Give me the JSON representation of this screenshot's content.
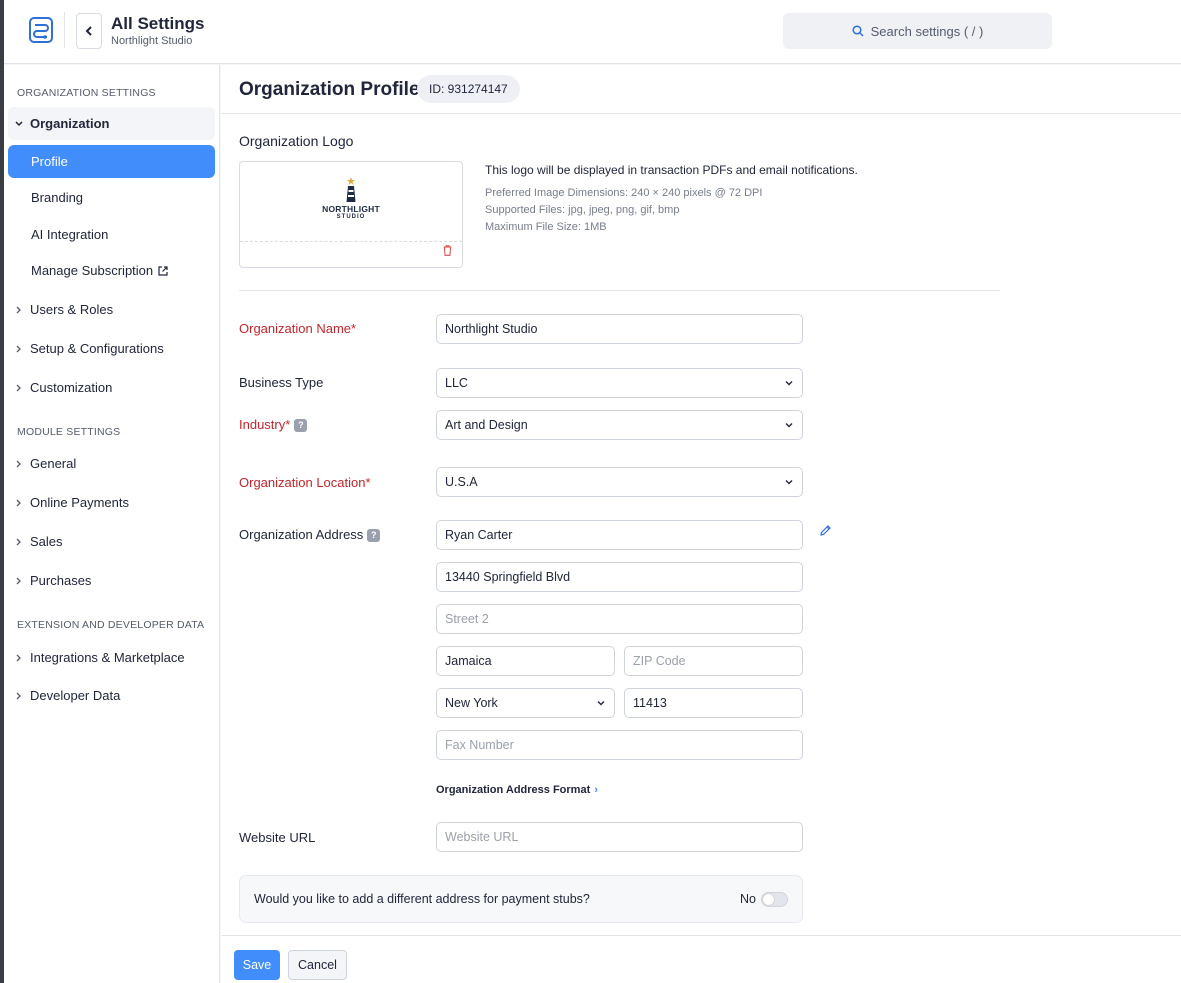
{
  "header": {
    "title": "All Settings",
    "subtitle": "Northlight Studio",
    "search_placeholder": "Search settings ( / )"
  },
  "sidebar": {
    "sections": [
      {
        "title": "ORGANIZATION SETTINGS"
      },
      {
        "title": "MODULE SETTINGS"
      },
      {
        "title": "EXTENSION AND DEVELOPER DATA"
      }
    ],
    "organization": {
      "label": "Organization"
    },
    "org_children": [
      {
        "label": "Profile",
        "active": true
      },
      {
        "label": "Branding"
      },
      {
        "label": "AI Integration"
      },
      {
        "label": "Manage Subscription"
      }
    ],
    "items": [
      {
        "label": "Users & Roles"
      },
      {
        "label": "Setup & Configurations"
      },
      {
        "label": "Customization"
      },
      {
        "label": "General"
      },
      {
        "label": "Online Payments"
      },
      {
        "label": "Sales"
      },
      {
        "label": "Purchases"
      },
      {
        "label": "Integrations & Marketplace"
      },
      {
        "label": "Developer Data"
      }
    ]
  },
  "main": {
    "title": "Organization Profile",
    "id_badge": "ID: 931274147",
    "logo": {
      "section_label": "Organization Logo",
      "brand_line1": "NORTHLIGHT",
      "brand_line2": "STUDIO",
      "description": "This logo will be displayed in transaction PDFs and email notifications.",
      "meta": [
        "Preferred Image Dimensions: 240 × 240 pixels @ 72 DPI",
        "Supported Files: jpg, jpeg, png, gif, bmp",
        "Maximum File Size: 1MB"
      ]
    },
    "fields": {
      "org_name": {
        "label": "Organization Name*",
        "value": "Northlight Studio"
      },
      "business_type": {
        "label": "Business Type",
        "value": "LLC"
      },
      "industry": {
        "label": "Industry*",
        "value": "Art and Design"
      },
      "location": {
        "label": "Organization Location*",
        "value": "U.S.A"
      },
      "address": {
        "label": "Organization Address",
        "attention": "Ryan Carter",
        "street1": "13440 Springfield Blvd",
        "street2_placeholder": "Street 2",
        "city": "Jamaica",
        "zip_placeholder": "ZIP Code",
        "state": "New York",
        "zip": "11413",
        "fax_placeholder": "Fax Number",
        "format_link": "Organization Address Format"
      },
      "website": {
        "label": "Website URL",
        "placeholder": "Website URL"
      }
    },
    "payment_stub": {
      "question": "Would you like to add a different address for payment stubs?",
      "toggle_label": "No"
    },
    "footer": {
      "save": "Save",
      "cancel": "Cancel"
    }
  },
  "colors": {
    "accent": "#408dfb",
    "required": "#c0262c",
    "delete": "#d9534f"
  }
}
